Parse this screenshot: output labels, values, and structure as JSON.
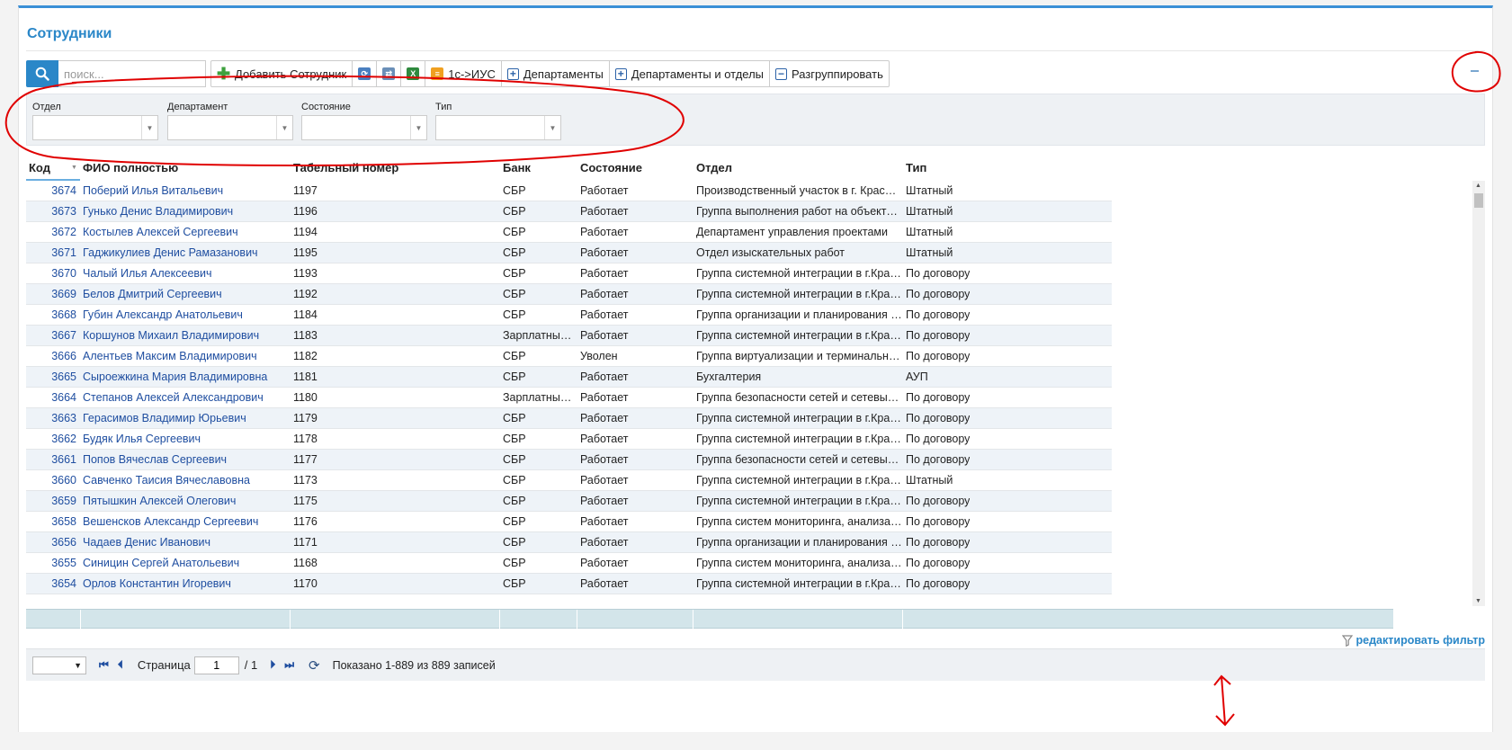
{
  "panel": {
    "title": "Сотрудники"
  },
  "search": {
    "placeholder": "поиск..."
  },
  "toolbar": {
    "add_employee": "Добавить Сотрудник",
    "sync_1c": "1с->ИУС",
    "departments": "Департаменты",
    "departments_and_units": "Департаменты и отделы",
    "ungroup": "Разгруппировать"
  },
  "filters": [
    {
      "label": "Отдел",
      "value": ""
    },
    {
      "label": "Департамент",
      "value": ""
    },
    {
      "label": "Состояние",
      "value": ""
    },
    {
      "label": "Тип",
      "value": ""
    }
  ],
  "grid": {
    "columns": [
      "Код",
      "ФИО полностью",
      "Табельный номер",
      "Банк",
      "Состояние",
      "Отдел",
      "Тип"
    ],
    "rows": [
      [
        "3674",
        "Поберий Илья Витальевич",
        "1197",
        "СБР",
        "Работает",
        "Производственный участок в г. Красн…",
        "Штатный"
      ],
      [
        "3673",
        "Гунько Денис Владимирович",
        "1196",
        "СБР",
        "Работает",
        "Группа выполнения работ на объекте …",
        "Штатный"
      ],
      [
        "3672",
        "Костылев Алексей Сергеевич",
        "1194",
        "СБР",
        "Работает",
        "Департамент управления проектами",
        "Штатный"
      ],
      [
        "3671",
        "Гаджикулиев Денис Рамазанович",
        "1195",
        "СБР",
        "Работает",
        "Отдел изыскательных работ",
        "Штатный"
      ],
      [
        "3670",
        "Чалый Илья Алексеевич",
        "1193",
        "СБР",
        "Работает",
        "Группа системной интеграции в г.Крас…",
        "По договору"
      ],
      [
        "3669",
        "Белов Дмитрий Сергеевич",
        "1192",
        "СБР",
        "Работает",
        "Группа системной интеграции в г.Крас…",
        "По договору"
      ],
      [
        "3668",
        "Губин Александр Анатольевич",
        "1184",
        "СБР",
        "Работает",
        "Группа организации и планирования р…",
        "По договору"
      ],
      [
        "3667",
        "Коршунов Михаил Владимирович",
        "1183",
        "Зарплатный…",
        "Работает",
        "Группа системной интеграции в г.Крас…",
        "По договору"
      ],
      [
        "3666",
        "Алентьев Максим Владимирович",
        "1182",
        "СБР",
        "Уволен",
        "Группа виртуализации и терминально…",
        "По договору"
      ],
      [
        "3665",
        "Сыроежкина Мария Владимировна",
        "1181",
        "СБР",
        "Работает",
        "Бухгалтерия",
        "АУП"
      ],
      [
        "3664",
        "Степанов Алексей Александрович",
        "1180",
        "Зарплатный…",
        "Работает",
        "Группа безопасности сетей и сетевых …",
        "По договору"
      ],
      [
        "3663",
        "Герасимов Владимир Юрьевич",
        "1179",
        "СБР",
        "Работает",
        "Группа системной интеграции в г.Крас…",
        "По договору"
      ],
      [
        "3662",
        "Будяк Илья Сергеевич",
        "1178",
        "СБР",
        "Работает",
        "Группа системной интеграции в г.Крас…",
        "По договору"
      ],
      [
        "3661",
        "Попов Вячеслав Сергеевич",
        "1177",
        "СБР",
        "Работает",
        "Группа безопасности сетей и сетевых …",
        "По договору"
      ],
      [
        "3660",
        "Савченко Таисия Вячеславовна",
        "1173",
        "СБР",
        "Работает",
        "Группа системной интеграции в г.Крас…",
        "Штатный"
      ],
      [
        "3659",
        "Пятышкин Алексей Олегович",
        "1175",
        "СБР",
        "Работает",
        "Группа системной интеграции в г.Крас…",
        "По договору"
      ],
      [
        "3658",
        "Вешенсков Александр Сергеевич",
        "1176",
        "СБР",
        "Работает",
        "Группа систем мониторинга, анализа …",
        "По договору"
      ],
      [
        "3656",
        "Чадаев Денис Иванович",
        "1171",
        "СБР",
        "Работает",
        "Группа организации и планирования р…",
        "По договору"
      ],
      [
        "3655",
        "Синицин Сергей Анатольевич",
        "1168",
        "СБР",
        "Работает",
        "Группа систем мониторинга, анализа …",
        "По договору"
      ],
      [
        "3654",
        "Орлов Константин Игоревич",
        "1170",
        "СБР",
        "Работает",
        "Группа системной интеграции в г.Крас…",
        "По договору"
      ]
    ]
  },
  "footer": {
    "edit_filter": "редактировать фильтр"
  },
  "pager": {
    "page_label": "Страница",
    "page": "1",
    "total": "/ 1",
    "status": "Показано 1-889 из 889 записей"
  },
  "colors": {
    "accent": "#2a87c8",
    "link": "#1f4ea0",
    "annotation": "#e00000"
  }
}
